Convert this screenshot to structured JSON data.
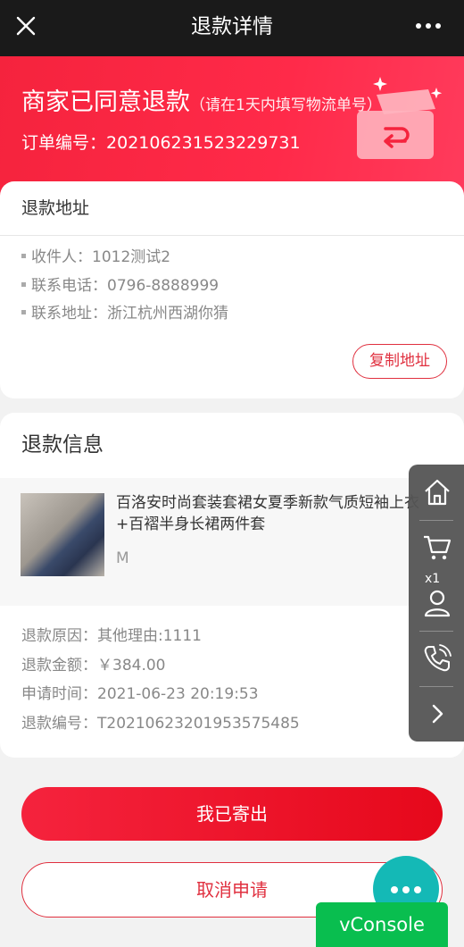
{
  "topbar": {
    "title": "退款详情"
  },
  "hero": {
    "status": "商家已同意退款",
    "hint": "（请在1天内填写物流单号）",
    "order_label": "订单编号：",
    "order_no": "202106231523229731"
  },
  "address": {
    "title": "退款地址",
    "receiver": "收件人：1012测试2",
    "phone": "联系电话：0796-8888999",
    "addr": "联系地址：浙江杭州西湖你猜",
    "copy_label": "复制地址"
  },
  "refund": {
    "title": "退款信息",
    "goods_name": "百洛安时尚套装套裙女夏季新款气质短袖上衣+百褶半身长裙两件套",
    "goods_spec": "M",
    "reason": "退款原因：其他理由:1111",
    "amount": "退款金额：￥384.00",
    "time": "申请时间：2021-06-23 20:19:53",
    "refund_no": "退款编号：T20210623201953575485"
  },
  "side_bar": {
    "cart_badge": "x1",
    "icons": [
      "home-icon",
      "cart-icon",
      "user-icon",
      "phone-icon",
      "chevron-right-icon"
    ]
  },
  "actions": {
    "shipped_label": "我已寄出",
    "cancel_label": "取消申请"
  },
  "vconsole": {
    "label": "vConsole"
  },
  "colors": {
    "accent": "#f5233d",
    "topbar": "#1a1a1a",
    "fab": "#14b9b6",
    "vconsole": "#09be4f"
  }
}
